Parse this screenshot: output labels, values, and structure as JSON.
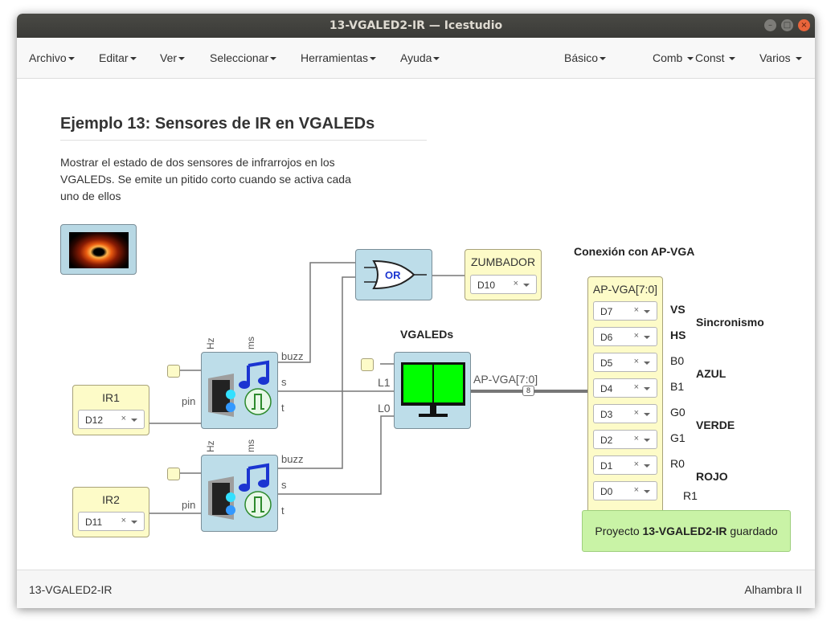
{
  "window": {
    "title": "13-VGALED2-IR — Icestudio"
  },
  "menu": {
    "left": [
      "Archivo",
      "Editar",
      "Ver",
      "Seleccionar",
      "Herramientas",
      "Ayuda"
    ],
    "right": [
      "Básico",
      "Comb",
      "Const",
      "Varios"
    ]
  },
  "doc": {
    "heading": "Ejemplo 13: Sensores de IR en VGALEDs",
    "description": "Mostrar el estado de dos sensores de infrarrojos en los VGALEDs. Se emite un pitido corto cuando se activa cada uno de ellos"
  },
  "blocks": {
    "ir1": {
      "title": "IR1",
      "pin": "D12"
    },
    "ir2": {
      "title": "IR2",
      "pin": "D11"
    },
    "zumbador": {
      "title": "ZUMBADOR",
      "pin": "D10"
    },
    "or_gate": {
      "label": "OR"
    },
    "vgaleds": {
      "title": "VGALEDs",
      "in1": "L1",
      "in0": "L0",
      "bus": "AP-VGA[7:0]",
      "bus_width": "8"
    },
    "sensor_labels": {
      "hz": "Hz",
      "ms": "ms",
      "buzz": "buzz",
      "s": "s",
      "t": "t",
      "pin": "pin"
    },
    "ap_vga": {
      "section_title": "Conexión con AP-VGA",
      "title": "AP-VGA[7:0]",
      "pins": [
        "D7",
        "D6",
        "D5",
        "D4",
        "D3",
        "D2",
        "D1",
        "D0"
      ],
      "signals": [
        "VS",
        "HS",
        "B0",
        "B1",
        "G0",
        "G1",
        "R0",
        "R1"
      ],
      "groups": [
        "Sincronismo",
        "AZUL",
        "VERDE",
        "ROJO"
      ]
    }
  },
  "status": {
    "prefix": "Proyecto ",
    "project": "13-VGALED2-IR",
    "suffix": " guardado"
  },
  "footer": {
    "project": "13-VGALED2-IR",
    "board": "Alhambra II"
  },
  "colors": {
    "block_blue": "#bddde9",
    "block_yellow": "#fdfbc8",
    "status_green": "#c9f3a6",
    "led_green": "#00ff00"
  }
}
